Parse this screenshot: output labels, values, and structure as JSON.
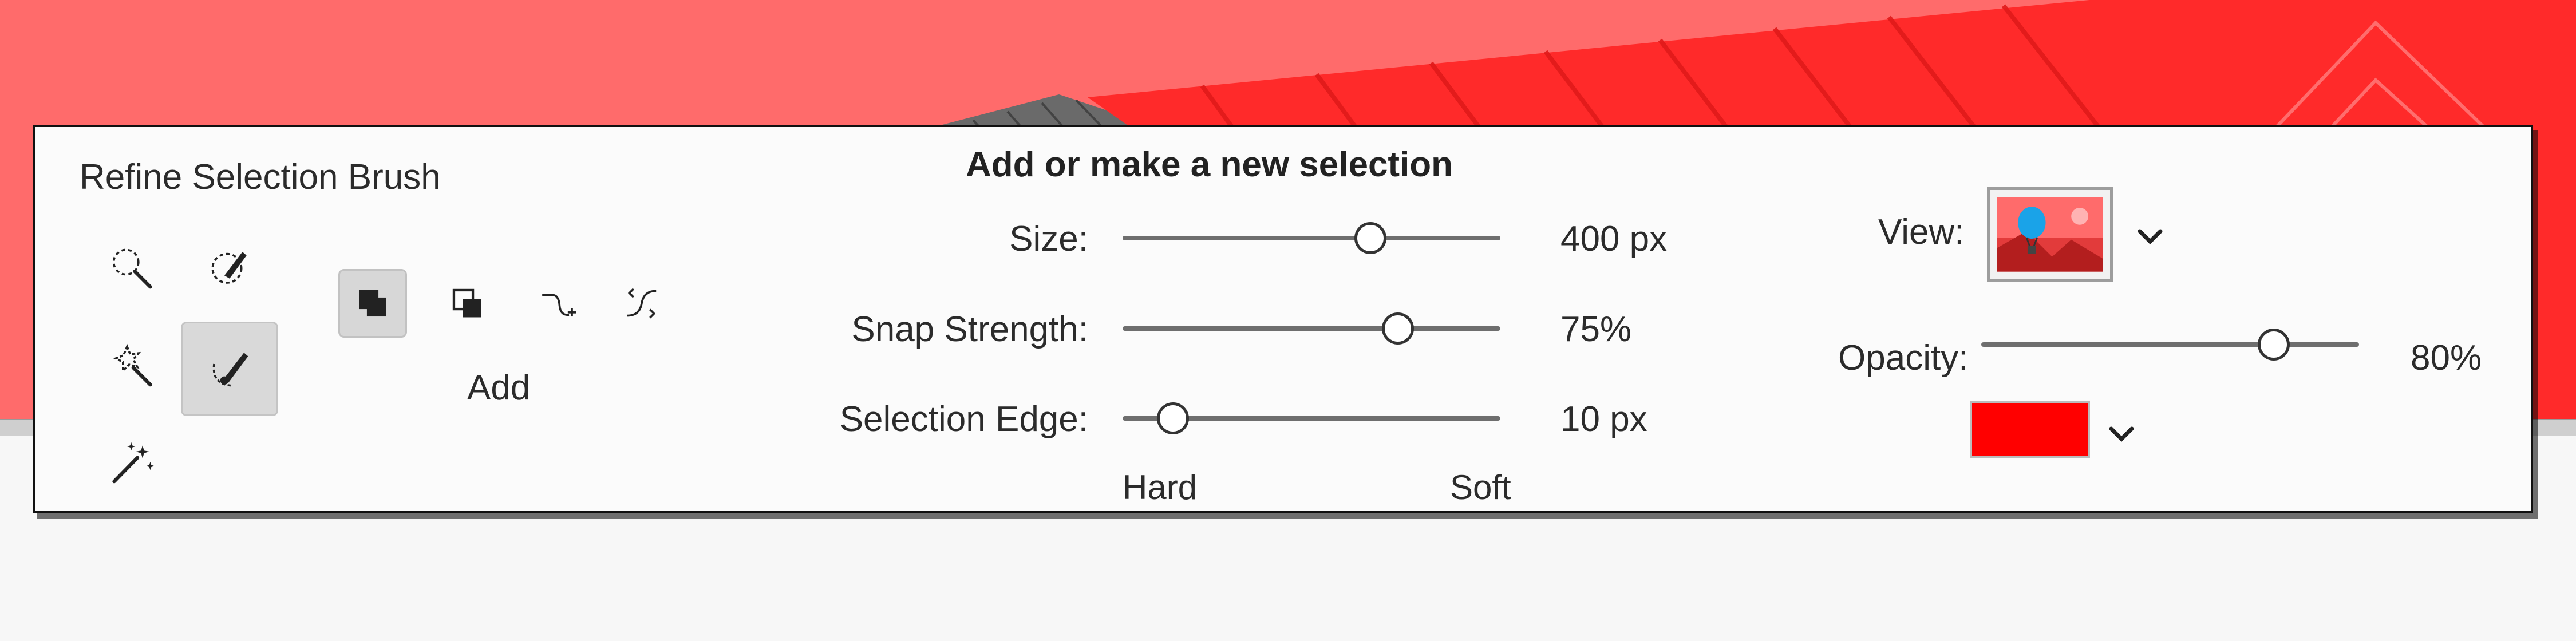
{
  "panel": {
    "title": "Refine Selection Brush",
    "heading": "Add or make a new selection",
    "mode_label": "Add"
  },
  "tools": [
    {
      "name": "lasso-brush-icon",
      "selected": false
    },
    {
      "name": "selection-brush-icon",
      "selected": false
    },
    {
      "name": "magic-wand-icon",
      "selected": false
    },
    {
      "name": "refine-selection-brush-icon",
      "selected": true
    },
    {
      "name": "auto-selection-icon",
      "selected": false
    }
  ],
  "modes": [
    {
      "name": "add-mode-icon",
      "selected": true
    },
    {
      "name": "new-selection-mode-icon",
      "selected": false
    },
    {
      "name": "push-mode-icon",
      "selected": false
    },
    {
      "name": "smooth-mode-icon",
      "selected": false
    }
  ],
  "sliders": {
    "size": {
      "label": "Size:",
      "value": "400 px",
      "fraction": 0.67
    },
    "snap": {
      "label": "Snap Strength:",
      "value": "75%",
      "fraction": 0.75
    },
    "edge": {
      "label": "Selection Edge:",
      "value": "10 px",
      "fraction": 0.1,
      "min_label": "Hard",
      "max_label": "Soft"
    }
  },
  "view": {
    "label": "View:",
    "opacity_label": "Opacity:",
    "opacity_value": "80%",
    "opacity_fraction": 0.8,
    "overlay_color": "#ff0000"
  },
  "colors": {
    "canvas": "#ff6b6b",
    "selection_red": "#ff2a2a",
    "roof_gray": "#555555"
  }
}
